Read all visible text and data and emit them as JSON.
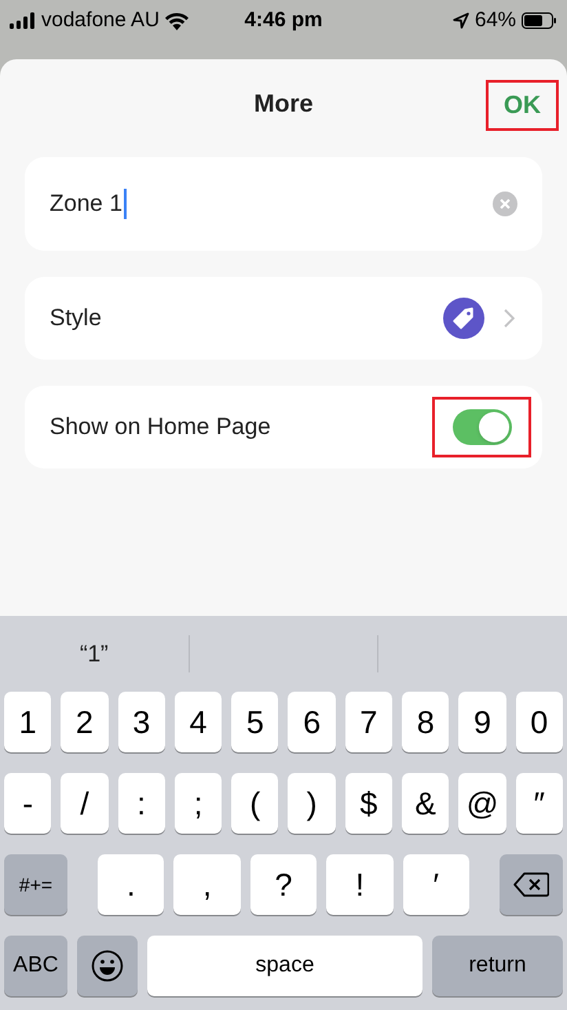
{
  "status_bar": {
    "carrier": "vodafone AU",
    "time": "4:46 pm",
    "battery": "64%"
  },
  "sheet": {
    "title": "More",
    "ok_button": {
      "label": "OK",
      "highlighted": true
    }
  },
  "name_field": {
    "value": "Zone 1"
  },
  "style_row": {
    "label": "Style"
  },
  "home_row": {
    "label": "Show on Home Page",
    "on": true,
    "highlighted": true
  },
  "keyboard": {
    "suggestions": [
      "“1”"
    ],
    "key_rows": [
      {
        "keys": [
          {
            "kind": "char",
            "label": "1"
          },
          {
            "kind": "char",
            "label": "2"
          },
          {
            "kind": "char",
            "label": "3"
          },
          {
            "kind": "char",
            "label": "4"
          },
          {
            "kind": "char",
            "label": "5"
          },
          {
            "kind": "char",
            "label": "6"
          },
          {
            "kind": "char",
            "label": "7"
          },
          {
            "kind": "char",
            "label": "8"
          },
          {
            "kind": "char",
            "label": "9"
          },
          {
            "kind": "char",
            "label": "0"
          }
        ]
      },
      {
        "keys": [
          {
            "kind": "char",
            "label": "-"
          },
          {
            "kind": "char",
            "label": "/"
          },
          {
            "kind": "char",
            "label": ":"
          },
          {
            "kind": "char",
            "label": ";"
          },
          {
            "kind": "char",
            "label": "("
          },
          {
            "kind": "char",
            "label": ")"
          },
          {
            "kind": "char",
            "label": "$"
          },
          {
            "kind": "char",
            "label": "&"
          },
          {
            "kind": "char",
            "label": "@"
          },
          {
            "kind": "char",
            "label": "″"
          }
        ]
      },
      {
        "keys": [
          {
            "kind": "function",
            "label": "#+="
          },
          {
            "kind": "wide",
            "label": "."
          },
          {
            "kind": "wide",
            "label": ","
          },
          {
            "kind": "wide",
            "label": "?"
          },
          {
            "kind": "wide",
            "label": "!"
          },
          {
            "kind": "wide",
            "label": "′"
          },
          {
            "kind": "delete"
          }
        ]
      },
      {
        "keys": [
          {
            "kind": "function",
            "label": "ABC"
          },
          {
            "kind": "emoji"
          },
          {
            "kind": "space",
            "label": "space"
          },
          {
            "kind": "return",
            "label": "return"
          }
        ]
      }
    ]
  }
}
